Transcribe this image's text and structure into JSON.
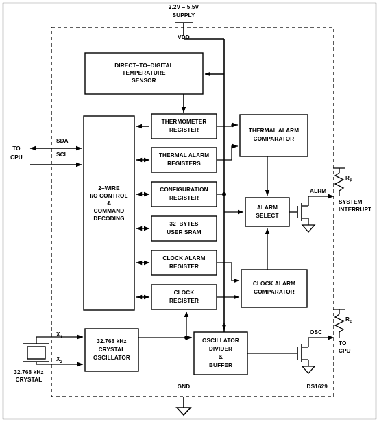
{
  "figure": {
    "chip_label": "DS1629",
    "supply": {
      "voltage": "2.2V – 5.5V",
      "word": "SUPPLY",
      "pin": "VDD"
    },
    "ground": {
      "pin": "GND"
    }
  },
  "blocks": [
    {
      "id": "temp-sensor",
      "lines": [
        "DIRECT–TO–DIGITAL",
        "TEMPERATURE",
        "SENSOR"
      ]
    },
    {
      "id": "io-control",
      "lines": [
        "2–WIRE",
        "I/O CONTROL",
        "&",
        "COMMAND",
        "DECODING"
      ]
    },
    {
      "id": "thermometer-register",
      "lines": [
        "THERMOMETER",
        "REGISTER"
      ]
    },
    {
      "id": "thermal-alarm-registers",
      "lines": [
        "THERMAL ALARM",
        "REGISTERS"
      ]
    },
    {
      "id": "configuration-register",
      "lines": [
        "CONFIGURATION",
        "REGISTER"
      ]
    },
    {
      "id": "user-sram",
      "lines": [
        "32–BYTES",
        "USER SRAM"
      ]
    },
    {
      "id": "clock-alarm-register",
      "lines": [
        "CLOCK ALARM",
        "REGISTER"
      ]
    },
    {
      "id": "clock-register",
      "lines": [
        "CLOCK",
        "REGISTER"
      ]
    },
    {
      "id": "thermal-alarm-comparator",
      "lines": [
        "THERMAL ALARM",
        "COMPARATOR"
      ]
    },
    {
      "id": "alarm-select",
      "lines": [
        "ALARM",
        "SELECT"
      ]
    },
    {
      "id": "clock-alarm-comparator",
      "lines": [
        "CLOCK ALARM",
        "COMPARATOR"
      ]
    },
    {
      "id": "crystal-oscillator",
      "lines": [
        "32.768 kHz",
        "CRYSTAL",
        "OSCILLATOR"
      ]
    },
    {
      "id": "oscillator-divider-buffer",
      "lines": [
        "OSCILLATOR",
        "DIVIDER",
        "&",
        "BUFFER"
      ]
    }
  ],
  "signals": {
    "sda": "SDA",
    "scl": "SCL",
    "to_cpu_left": [
      "TO",
      "CPU"
    ],
    "alrm": "ALRM",
    "system_interrupt": [
      "SYSTEM",
      "INTERRUPT"
    ],
    "osc": "OSC",
    "to_cpu_right": [
      "TO",
      "CPU"
    ],
    "x1": "X",
    "x1_sub": "1",
    "x2": "X",
    "x2_sub": "2",
    "crystal_caption": [
      "32.768 kHz",
      "CRYSTAL"
    ],
    "pullup": "R",
    "pullup_sub": "P"
  }
}
